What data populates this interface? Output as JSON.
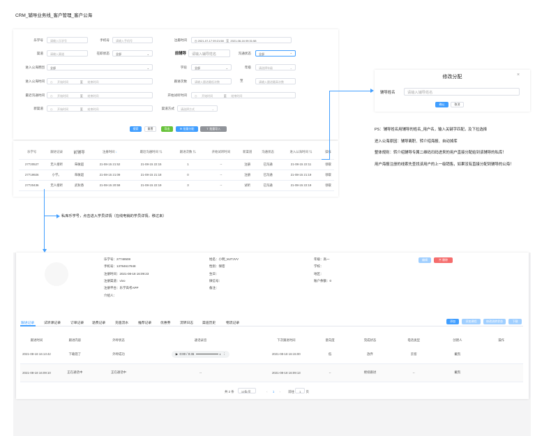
{
  "page_title": "CRM_辅导业务线_客户管理_客户公海",
  "filters": {
    "student_id": {
      "label": "乐学号",
      "placeholder": "请输入乐学号"
    },
    "phone": {
      "label": "手机号",
      "placeholder": "请输入手机号"
    },
    "reg_time": {
      "label": "注册时间",
      "start": "2021-07-17 09:21:58",
      "to": "至",
      "end": "2021-08-16 09:31:58"
    },
    "channel": {
      "label": "渠道",
      "placeholder": "请输入渠道"
    },
    "job_status": {
      "label": "在职状态",
      "value": "全部"
    },
    "prev_tutor": {
      "label": "前辅导",
      "placeholder": "请输入辅导姓名"
    },
    "comm_status": {
      "label": "沟通状态",
      "value": "全部"
    },
    "sea_reason": {
      "label": "进入公海原因",
      "value": "全部"
    },
    "section": {
      "label": "学段",
      "value": "全部"
    },
    "grade": {
      "label": "年级",
      "placeholder": "请选择年级"
    },
    "sea_time": {
      "label": "进入公海时间",
      "start": "开始时间",
      "to": "至",
      "end": "结束时间"
    },
    "follow_count": {
      "label": "跟进次数",
      "placeholder": "请输入跟进最低次数",
      "to": "至",
      "placeholder2": "请输入跟进最高次数"
    },
    "last_follow": {
      "label": "最近沟通时间",
      "start": "开始时间",
      "to": "至",
      "end": "结束时间"
    },
    "trial_time": {
      "label": "开始试听时间",
      "start": "开始时间",
      "to": "至",
      "end": "结束时间"
    },
    "new_channel": {
      "label": "新渠道",
      "start": "开始时间",
      "to": "至",
      "end": "结束时间"
    },
    "channel_mode": {
      "label": "渠道方式",
      "placeholder": "请选择方式"
    }
  },
  "actions": {
    "search": "搜索",
    "reset": "重置",
    "export": "导出",
    "batch_assign": "批量分配",
    "import": "批量导入"
  },
  "table1": {
    "headers": [
      "乐学号",
      "跟进记录",
      "前辅导",
      "注册时间",
      "最近沟通时间",
      "跟进次数",
      "开始试听时间",
      "新渠道",
      "沟通状态",
      "进入公海时间",
      "操作"
    ],
    "rows": [
      [
        "27720527",
        "无人接听",
        "朱敏超",
        "21-08-15 21:52",
        "21-08-15 22:15",
        "1",
        "--",
        "注册",
        "已沟通",
        "21-08-15 22:11",
        "领取"
      ],
      [
        "27719926",
        "小学。",
        "朱敏超",
        "21-08-15 21:09",
        "21-08-15 21:18",
        "0",
        "--",
        "注册",
        "已沟通",
        "21-08-15 21:19",
        "领取"
      ],
      [
        "27720436",
        "无人接听",
        "武秋香",
        "21-08-15 20:59",
        "21-08-15 22:19",
        "3",
        "--",
        "试听",
        "已沟通",
        "21-08-15 22:19",
        "领取"
      ]
    ]
  },
  "dialog": {
    "title": "修改分配",
    "field_label": "辅导姓名",
    "placeholder": "请输入辅导姓名",
    "ok": "确认",
    "cancel": "取消",
    "close": "×"
  },
  "notes": [
    "PS：辅导姓名用辅导的姓名_用户名，输入关键字匹配，及下拉选择",
    "进入公海原因：辅导离职、转介绍海报、自动掉库",
    "整体规则：转介绍辅导专属二维码扫码进来的用户直接分配给到该辅导的私库！",
    "用户海报注册的线索先查找该用户的上一级销售，如果没有直接分配到辅导的公海！"
  ],
  "annotation": "私库乐学号，点击进入学员详情（在线电销的学员详情，移过来）",
  "detail": {
    "left": [
      "乐学号：27748508",
      "手机号：13784617848",
      "注册时间：2021-08-18 16:09:23",
      "注册渠道：vivo",
      "注册平台：乐学高考APP",
      "介绍人："
    ],
    "mid": [
      "姓名：小明_MJTJVV",
      "性别：保密",
      "生日：",
      "微信号：",
      "备注："
    ],
    "right": [
      "年级：高一",
      "学校：",
      "地区：",
      "账户余额：0"
    ],
    "btn_edit": "编辑",
    "btn_delete": "删除",
    "tabs": [
      "跟进记录",
      "试听课记录",
      "订单记录",
      "退费记录",
      "充值流水",
      "推荐记录",
      "优惠券",
      "流转日志",
      "渠道历史",
      "物流记录"
    ],
    "tab_buttons": [
      "添加",
      "添加课程",
      "修改流转状态",
      "下载"
    ],
    "headers": [
      "跟进时间",
      "跟进内容",
      "外呼状态",
      "通话录音",
      "下次跟进时间",
      "意向度",
      "完成状态",
      "电话类型",
      "创建人",
      "操作"
    ],
    "rows": [
      [
        "2021-08-18 16:13:42",
        "下载错了",
        "外呼成功",
        "0:00 / 0:45",
        "2021-08-18 16:15:00",
        "低",
        "放弃",
        "云客",
        "戴凯",
        ""
      ],
      [
        "2021-08-18 16:09:10",
        "正在通话中",
        "正在通话中",
        "--",
        "2021-08-18 16:09:13",
        "--",
        "继续跟进",
        "--",
        "戴凯",
        ""
      ]
    ],
    "pager": {
      "total": "共 2 条",
      "size": "10条/页",
      "prev": "‹",
      "page": "1",
      "next": "›",
      "goto": "前往",
      "goto_val": "1",
      "unit": "页"
    }
  }
}
